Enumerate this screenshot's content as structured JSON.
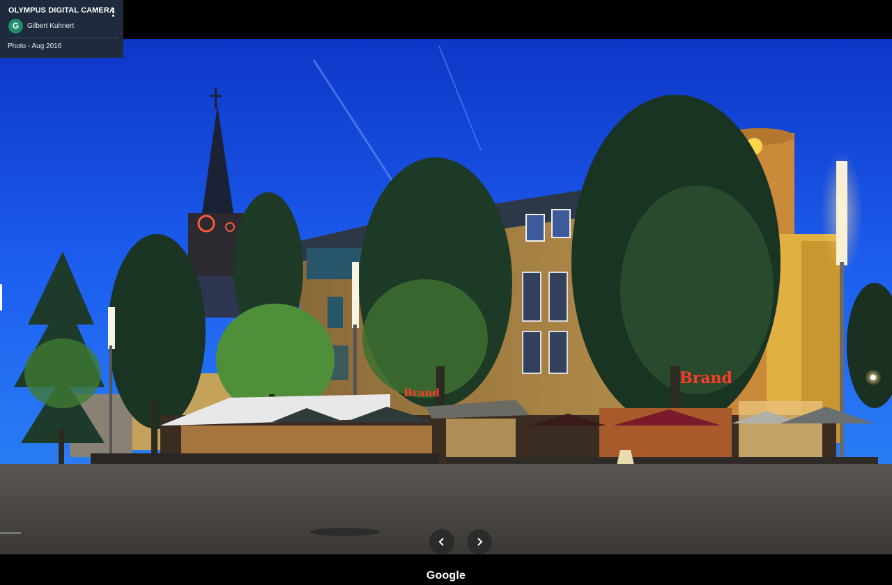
{
  "info_card": {
    "title": "OLYMPUS DIGITAL CAMERA",
    "avatar_letter": "G",
    "author": "Gilbert Kuhnert",
    "date": "Photo - Aug 2016"
  },
  "photo_signs": {
    "sign_left": "Brand",
    "sign_right": "Brand"
  },
  "footer": {
    "logo": "Google"
  },
  "icons": {
    "more": "more-vert-icon",
    "prev": "chevron-left-icon",
    "next": "chevron-right-icon"
  },
  "colors": {
    "avatar": "#1e8e6e",
    "card_bg": "#1f2b3d",
    "sky": "#1d4fe0"
  }
}
